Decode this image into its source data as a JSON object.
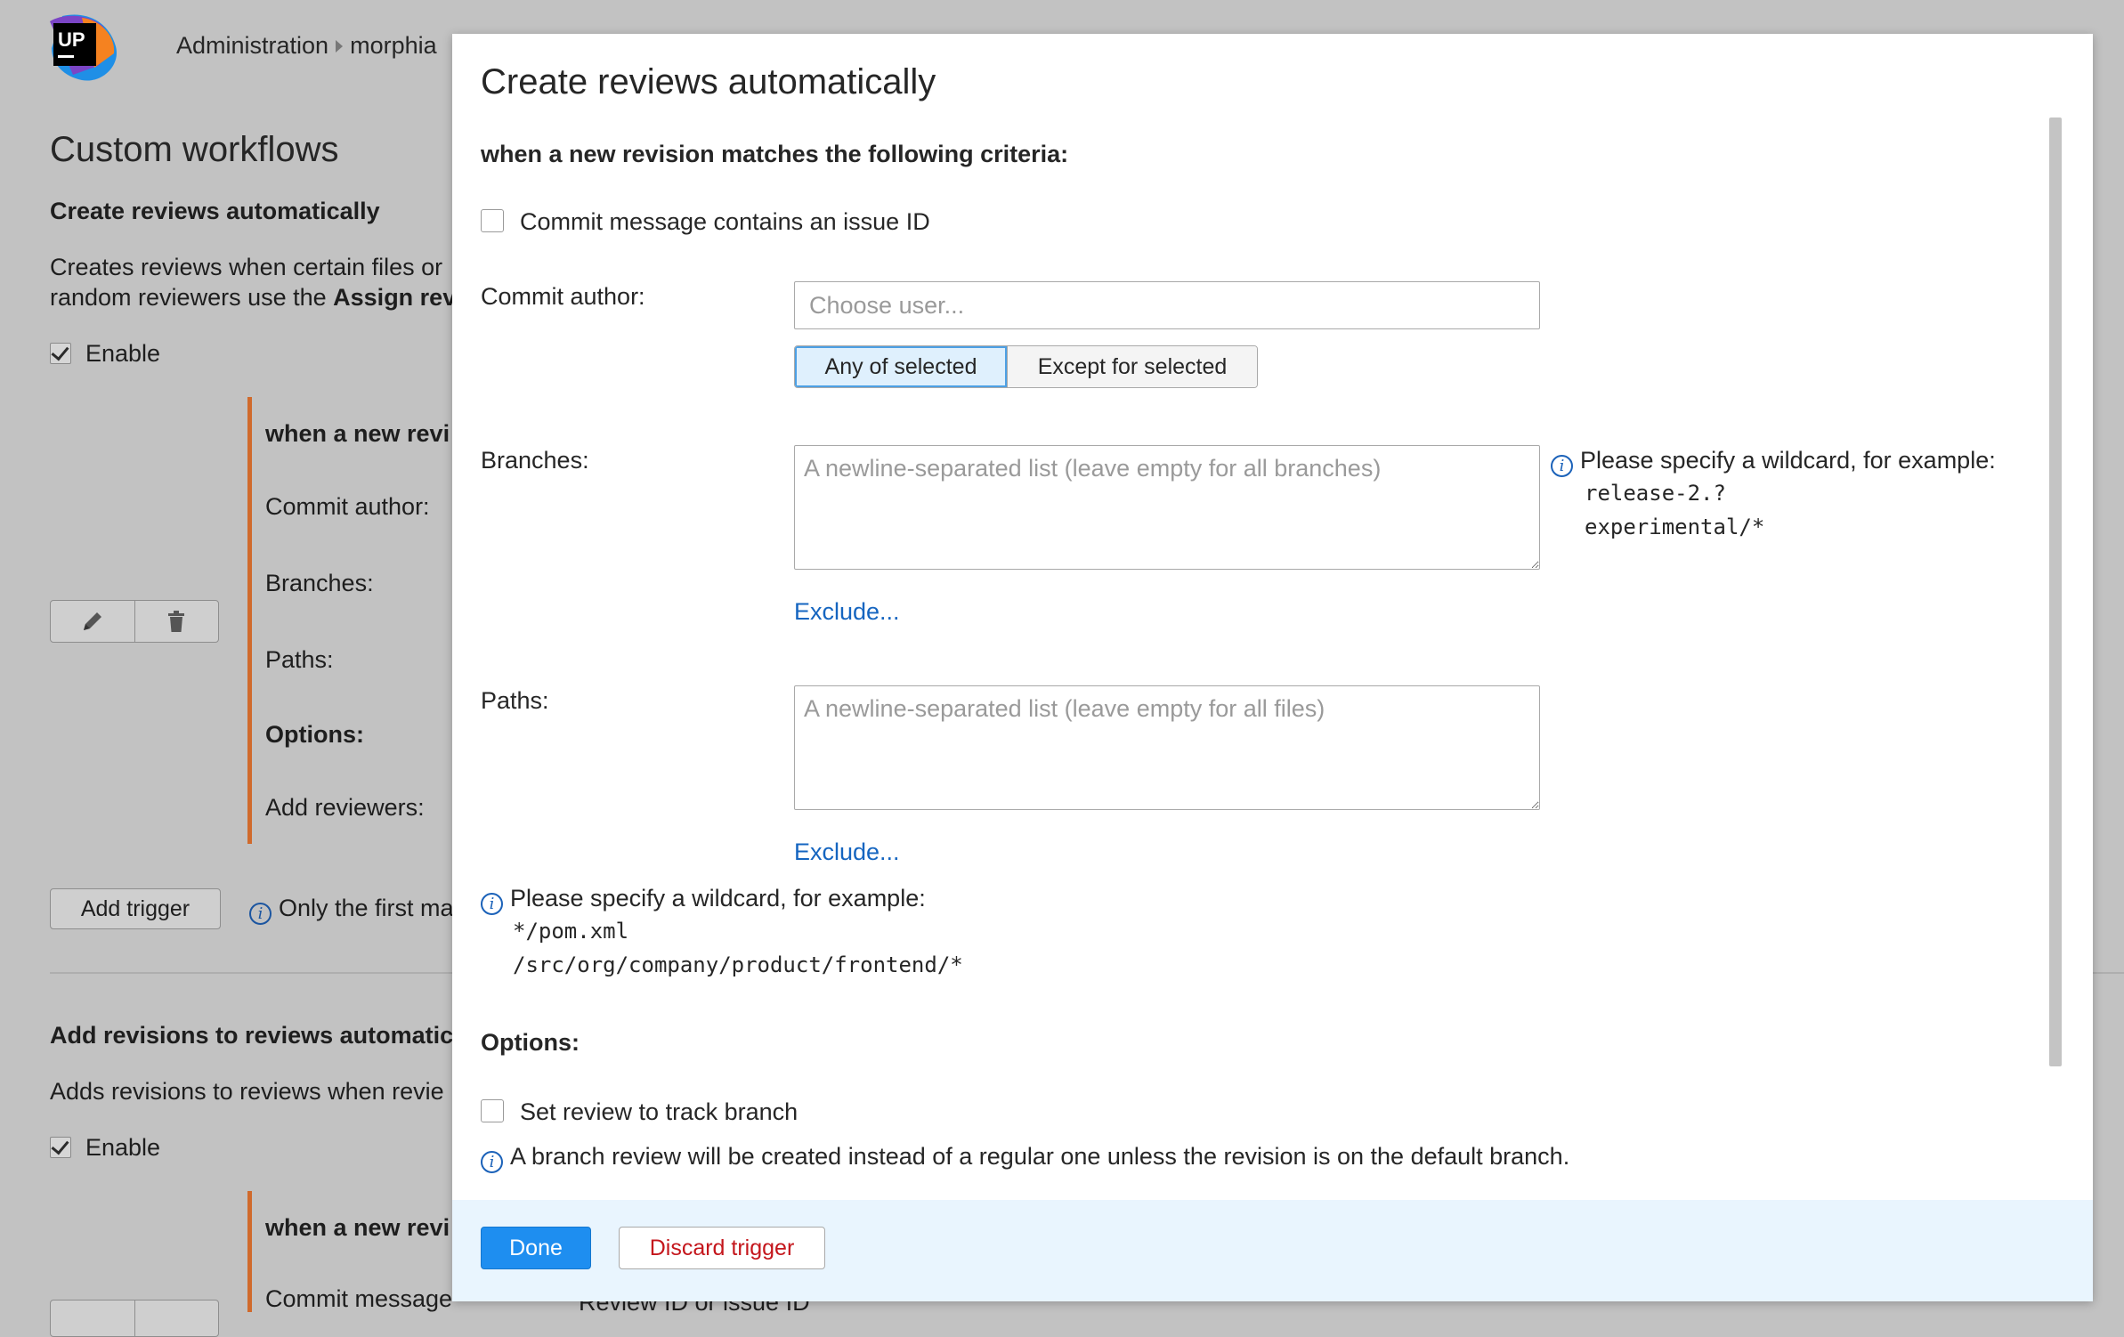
{
  "header": {
    "logo_text": "UP",
    "breadcrumb": [
      "Administration",
      "morphia"
    ]
  },
  "background": {
    "page_title": "Custom workflows",
    "section1": {
      "title": "Create reviews automatically",
      "desc_line1": "Creates reviews when certain files or",
      "desc_line2_prefix": "random reviewers use the ",
      "desc_line2_bold": "Assign rev",
      "enable_label": "Enable",
      "trigger_heading": "when a new revi",
      "labels": [
        "Commit author:",
        "Branches:",
        "Paths:"
      ],
      "options_label": "Options:",
      "add_reviewers_label": "Add reviewers:",
      "add_trigger_label": "Add trigger",
      "hint": "Only the first ma"
    },
    "section2": {
      "title": "Add revisions to reviews automatic",
      "desc": "Adds revisions to reviews when revie",
      "enable_label": "Enable",
      "trigger_heading": "when a new revi",
      "commit_message_label": "Commit message",
      "behind_text": "Review ID or issue ID"
    }
  },
  "modal": {
    "title": "Create reviews automatically",
    "subtitle": "when a new revision matches the following criteria:",
    "issue_checkbox_label": "Commit message contains an issue ID",
    "commit_author_label": "Commit author:",
    "commit_author_placeholder": "Choose user...",
    "author_toggle": {
      "options": [
        "Any of selected",
        "Except for selected"
      ],
      "selected": "Any of selected"
    },
    "branches_label": "Branches:",
    "branches_placeholder": "A newline-separated list (leave empty for all branches)",
    "branches_exclude": "Exclude...",
    "branches_hint": {
      "text": "Please specify a wildcard, for example:",
      "examples": [
        "release-2.?",
        "experimental/*"
      ]
    },
    "paths_label": "Paths:",
    "paths_placeholder": "A newline-separated list (leave empty for all files)",
    "paths_exclude": "Exclude...",
    "paths_hint": {
      "text": "Please specify a wildcard, for example:",
      "examples": [
        "*/pom.xml",
        "/src/org/company/product/frontend/*"
      ]
    },
    "options_label": "Options:",
    "track_branch_label": "Set review to track branch",
    "track_branch_hint": "A branch review will be created instead of a regular one unless the revision is on the default branch.",
    "done_label": "Done",
    "discard_label": "Discard trigger"
  },
  "colors": {
    "accent_blue": "#1e8ef0",
    "link_blue": "#1565c0",
    "discard_red": "#c4161c",
    "trigger_rule_orange": "#d06a2c",
    "footer_bg": "#e9f5fe"
  },
  "icons": [
    "upsource-logo",
    "pencil-icon",
    "trash-icon",
    "info-icon",
    "checkmark-icon"
  ]
}
